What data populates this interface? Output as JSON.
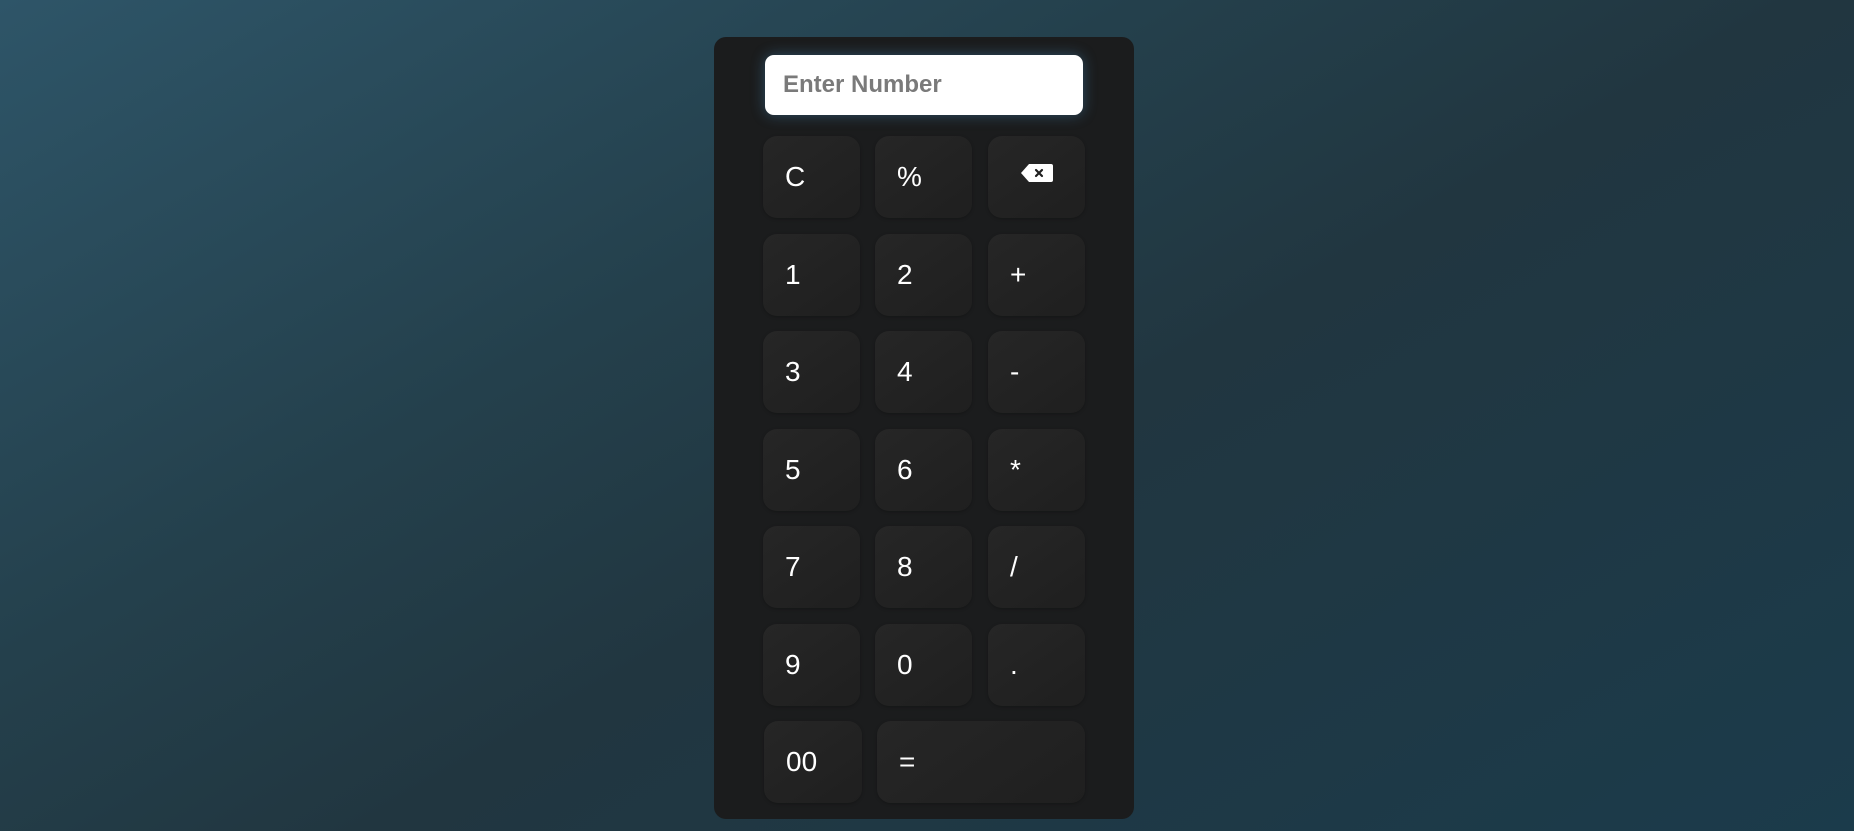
{
  "display": {
    "placeholder": "Enter Number",
    "value": ""
  },
  "keys": {
    "clear": "C",
    "percent": "%",
    "backspace_icon": "backspace-icon",
    "one": "1",
    "two": "2",
    "plus": "+",
    "three": "3",
    "four": "4",
    "minus": "-",
    "five": "5",
    "six": "6",
    "multiply": "*",
    "seven": "7",
    "eight": "8",
    "divide": "/",
    "nine": "9",
    "zero": "0",
    "dot": ".",
    "double_zero": "00",
    "equals": "="
  },
  "colors": {
    "panel": "#1b1c1d",
    "key": "#232323",
    "key_text": "#ffffff",
    "display_bg": "#ffffff",
    "display_glow": "#50aae6"
  }
}
